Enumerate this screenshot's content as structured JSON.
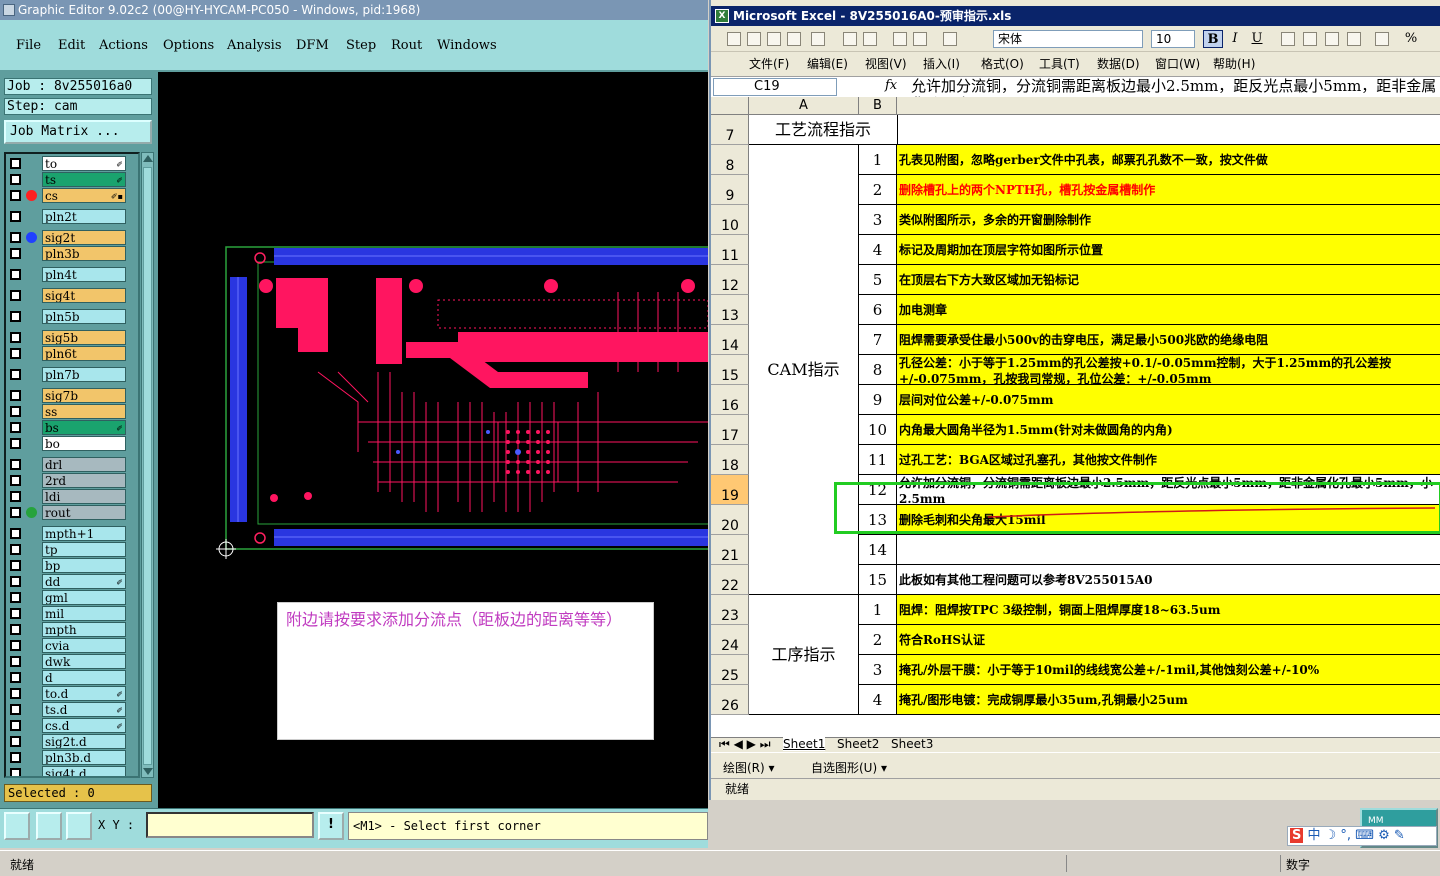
{
  "graphic_editor": {
    "title": "Graphic Editor 9.02c2 (00@HY-HYCAM-PC050 - Windows, pid:1968)",
    "menu": [
      "File",
      "Edit",
      "Actions",
      "Options",
      "Analysis",
      "DFM",
      "Step",
      "Rout",
      "Windows"
    ],
    "job_label": "Job : 8v255016a0",
    "step_label": "Step: cam",
    "job_matrix_button": "Job Matrix ...",
    "layers": [
      {
        "name": "to",
        "color": "#ffffff",
        "dot": "",
        "sub": "✐"
      },
      {
        "name": "ts",
        "color": "#1aa36e",
        "dot": "",
        "sub": "✐"
      },
      {
        "name": "cs",
        "color": "#f2c56a",
        "dot": "#ff2020",
        "sub": "✐▪"
      },
      {
        "name": "pln2t",
        "color": "#a8e6ec",
        "dot": "",
        "sub": ""
      },
      {
        "name": "sig2t",
        "color": "#f2c56a",
        "dot": "#2040ff",
        "sub": ""
      },
      {
        "name": "pln3b",
        "color": "#f2c56a",
        "dot": "",
        "sub": ""
      },
      {
        "name": "pln4t",
        "color": "#a8e6ec",
        "dot": "",
        "sub": ""
      },
      {
        "name": "sig4t",
        "color": "#f2c56a",
        "dot": "",
        "sub": ""
      },
      {
        "name": "pln5b",
        "color": "#a8e6ec",
        "dot": "",
        "sub": ""
      },
      {
        "name": "sig5b",
        "color": "#f2c56a",
        "dot": "",
        "sub": ""
      },
      {
        "name": "pln6t",
        "color": "#f2c56a",
        "dot": "",
        "sub": ""
      },
      {
        "name": "pln7b",
        "color": "#a8e6ec",
        "dot": "",
        "sub": ""
      },
      {
        "name": "sig7b",
        "color": "#f2c56a",
        "dot": "",
        "sub": ""
      },
      {
        "name": "ss",
        "color": "#f2c56a",
        "dot": "",
        "sub": ""
      },
      {
        "name": "bs",
        "color": "#1aa36e",
        "dot": "",
        "sub": "✐"
      },
      {
        "name": "bo",
        "color": "#ffffff",
        "dot": "",
        "sub": ""
      },
      {
        "name": "drl",
        "color": "#a7b9bf",
        "dot": "",
        "sub": ""
      },
      {
        "name": "2rd",
        "color": "#a7b9bf",
        "dot": "",
        "sub": ""
      },
      {
        "name": "ldi",
        "color": "#a7b9bf",
        "dot": "",
        "sub": ""
      },
      {
        "name": "rout",
        "color": "#a7b9bf",
        "dot": "#26a33c",
        "sub": ""
      },
      {
        "name": "mpth+1",
        "color": "#a8e6ec",
        "dot": "",
        "sub": ""
      },
      {
        "name": "tp",
        "color": "#a8e6ec",
        "dot": "",
        "sub": ""
      },
      {
        "name": "bp",
        "color": "#a8e6ec",
        "dot": "",
        "sub": ""
      },
      {
        "name": "dd",
        "color": "#a8e6ec",
        "dot": "",
        "sub": "✐"
      },
      {
        "name": "gml",
        "color": "#a8e6ec",
        "dot": "",
        "sub": ""
      },
      {
        "name": "mil",
        "color": "#a8e6ec",
        "dot": "",
        "sub": ""
      },
      {
        "name": "mpth",
        "color": "#a8e6ec",
        "dot": "",
        "sub": ""
      },
      {
        "name": "cvia",
        "color": "#a8e6ec",
        "dot": "",
        "sub": ""
      },
      {
        "name": "dwk",
        "color": "#a8e6ec",
        "dot": "",
        "sub": ""
      },
      {
        "name": "d",
        "color": "#a8e6ec",
        "dot": "",
        "sub": ""
      },
      {
        "name": "to.d",
        "color": "#a8e6ec",
        "dot": "",
        "sub": "✐"
      },
      {
        "name": "ts.d",
        "color": "#a8e6ec",
        "dot": "",
        "sub": "✐"
      },
      {
        "name": "cs.d",
        "color": "#a8e6ec",
        "dot": "",
        "sub": "✐"
      },
      {
        "name": "sig2t.d",
        "color": "#a8e6ec",
        "dot": "",
        "sub": ""
      },
      {
        "name": "pln3b.d",
        "color": "#a8e6ec",
        "dot": "",
        "sub": ""
      },
      {
        "name": "sig4t.d",
        "color": "#a8e6ec",
        "dot": "",
        "sub": ""
      }
    ],
    "selected_label": "Selected : 0",
    "xy_label": "X Y :",
    "info_button": "!",
    "prompt": "<M1> - Select first corner",
    "note": "附边请按要求添加分流点（距板边的距离等等）"
  },
  "excel": {
    "title": "Microsoft Excel - 8V255016A0-预审指示.xls",
    "font_name": "宋体",
    "font_size": "10",
    "fmt_buttons": [
      "B",
      "I",
      "U"
    ],
    "percent": "%",
    "menu": [
      "文件(F)",
      "编辑(E)",
      "视图(V)",
      "插入(I)",
      "格式(O)",
      "工具(T)",
      "数据(D)",
      "窗口(W)",
      "帮助(H)"
    ],
    "name_box": "C19",
    "fx": "fx",
    "formula": "允许加分流铜，分流铜需距离板边最小2.5mm，距反光点最小5mm，距非金属化孔最小2.5mm",
    "col_headers": [
      "A",
      "B"
    ],
    "header_row": {
      "row": "7",
      "text": "工艺流程指示"
    },
    "sections": [
      {
        "label": "CAM指示",
        "start": 0,
        "span": 15
      },
      {
        "label": "工序指示",
        "start": 15,
        "span": 4
      }
    ],
    "rows": [
      {
        "row": "8",
        "num": "1",
        "text": "孔表见附图，忽略gerber文件中孔表，邮票孔孔数不一致，按文件做",
        "yellow": true,
        "red": false
      },
      {
        "row": "9",
        "num": "2",
        "text": "删除槽孔上的两个NPTH孔，槽孔按金属槽制作",
        "yellow": true,
        "red": true
      },
      {
        "row": "10",
        "num": "3",
        "text": "类似附图所示，多余的开窗删除制作",
        "yellow": true,
        "red": false
      },
      {
        "row": "11",
        "num": "4",
        "text": "标记及周期加在顶层字符如图所示位置",
        "yellow": true,
        "red": false
      },
      {
        "row": "12",
        "num": "5",
        "text": "在顶层右下方大致区域加无铅标记",
        "yellow": true,
        "red": false
      },
      {
        "row": "13",
        "num": "6",
        "text": "加电测章",
        "yellow": true,
        "red": false
      },
      {
        "row": "14",
        "num": "7",
        "text": "阻焊需要承受住最小500v的击穿电压，满足最小500兆欧的绝缘电阻",
        "yellow": true,
        "red": false
      },
      {
        "row": "15",
        "num": "8",
        "text": "孔径公差：小于等于1.25mm的孔公差按+0.1/-0.05mm控制，大于1.25mm的孔公差按+/-0.075mm，孔按我司常规，孔位公差：+/-0.05mm",
        "yellow": true,
        "red": false,
        "wrap": true
      },
      {
        "row": "16",
        "num": "9",
        "text": "层间对位公差+/-0.075mm",
        "yellow": true,
        "red": false
      },
      {
        "row": "17",
        "num": "10",
        "text": "内角最大圆角半径为1.5mm(针对未做圆角的内角)",
        "yellow": true,
        "red": false
      },
      {
        "row": "18",
        "num": "11",
        "text": "过孔工艺：BGA区域过孔塞孔，其他按文件制作",
        "yellow": true,
        "red": false
      },
      {
        "row": "19",
        "num": "12",
        "text": "允许加分流铜，分流铜需距离板边最小2.5mm，距反光点最小5mm，距非金属化孔最小5mm，小2.5mm",
        "yellow": false,
        "red": false,
        "wrap": true
      },
      {
        "row": "20",
        "num": "13",
        "text": "删除毛刺和尖角最大15mil",
        "yellow": true,
        "red": false
      },
      {
        "row": "21",
        "num": "14",
        "text": "",
        "yellow": false,
        "red": false
      },
      {
        "row": "22",
        "num": "15",
        "text": "此板如有其他工程问题可以参考8V255015A0",
        "yellow": false,
        "red": false
      },
      {
        "row": "23",
        "num": "1",
        "text": "阻焊：阻焊按TPC 3级控制，铜面上阻焊厚度18~63.5um",
        "yellow": true,
        "red": false
      },
      {
        "row": "24",
        "num": "2",
        "text": "符合RoHS认证",
        "yellow": true,
        "red": false
      },
      {
        "row": "25",
        "num": "3",
        "text": "掩孔/外层干膜：小于等于10mil的线线宽公差+/-1mil,其他蚀刻公差+/-10%",
        "yellow": true,
        "red": false
      },
      {
        "row": "26",
        "num": "4",
        "text": "掩孔/图形电镀：完成铜厚最小35um,孔铜最小25um",
        "yellow": true,
        "red": false
      }
    ],
    "sheet_tabs": [
      "Sheet1",
      "Sheet2",
      "Sheet3"
    ],
    "draw_toolbar": [
      "绘图(R) ▾",
      "自选图形(U) ▾"
    ],
    "status": "就绪"
  },
  "tray": {
    "mm": "MM",
    "ime": "中 ☽ °, ⌨ ⚙ ✎",
    "ime_logo": "S"
  },
  "statusbar": {
    "left": "就绪",
    "right": "数字"
  }
}
